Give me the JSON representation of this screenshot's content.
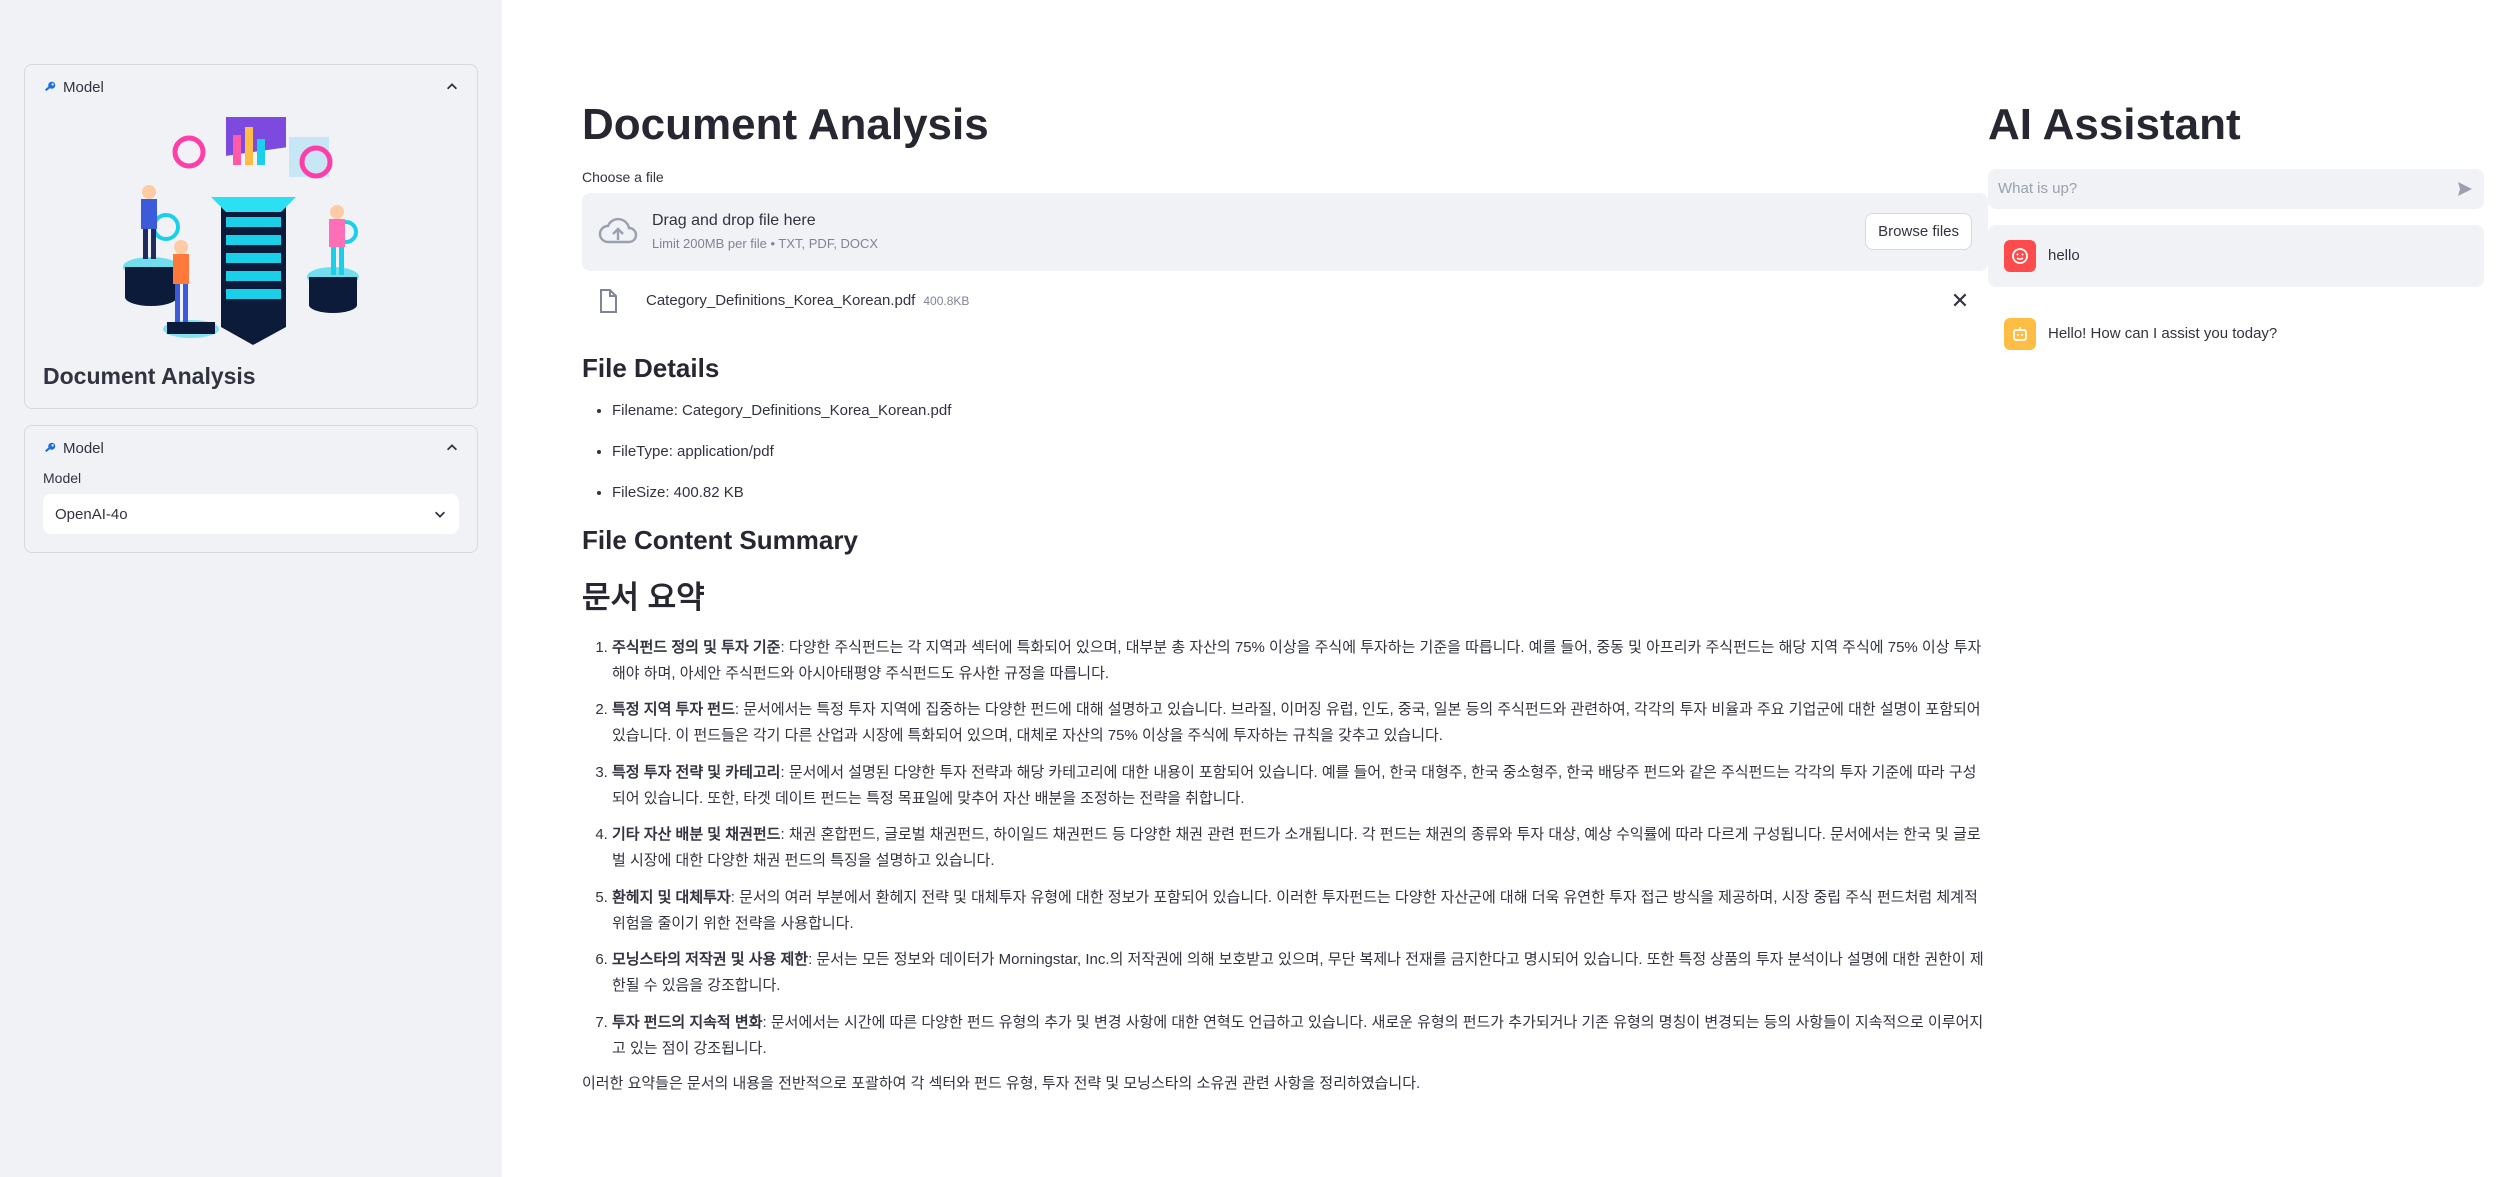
{
  "sidebar": {
    "illustration_expander": {
      "label": "Model",
      "title": "Document Analysis"
    },
    "model_expander": {
      "label": "Model",
      "field_label": "Model",
      "selected_value": "OpenAI-4o"
    }
  },
  "main": {
    "title": "Document Analysis",
    "uploader": {
      "label": "Choose a file",
      "drop_text": "Drag and drop file here",
      "limit_text": "Limit 200MB per file • TXT, PDF, DOCX",
      "browse_label": "Browse files",
      "file_name": "Category_Definitions_Korea_Korean.pdf",
      "file_size": "400.8KB"
    },
    "file_details": {
      "heading": "File Details",
      "items": [
        "Filename: Category_Definitions_Korea_Korean.pdf",
        "FileType: application/pdf",
        "FileSize: 400.82 KB"
      ]
    },
    "summary": {
      "heading": "File Content Summary",
      "subheading": "문서 요약",
      "items": [
        {
          "bold": "주식펀드 정의 및 투자 기준",
          "text": ": 다양한 주식펀드는 각 지역과 섹터에 특화되어 있으며, 대부분 총 자산의 75% 이상을 주식에 투자하는 기준을 따릅니다. 예를 들어, 중동 및 아프리카 주식펀드는 해당 지역 주식에 75% 이상 투자해야 하며, 아세안 주식펀드와 아시아태평양 주식펀드도 유사한 규정을 따릅니다."
        },
        {
          "bold": "특정 지역 투자 펀드",
          "text": ": 문서에서는 특정 투자 지역에 집중하는 다양한 펀드에 대해 설명하고 있습니다. 브라질, 이머징 유럽, 인도, 중국, 일본 등의 주식펀드와 관련하여, 각각의 투자 비율과 주요 기업군에 대한 설명이 포함되어 있습니다. 이 펀드들은 각기 다른 산업과 시장에 특화되어 있으며, 대체로 자산의 75% 이상을 주식에 투자하는 규칙을 갖추고 있습니다."
        },
        {
          "bold": "특정 투자 전략 및 카테고리",
          "text": ": 문서에서 설명된 다양한 투자 전략과 해당 카테고리에 대한 내용이 포함되어 있습니다. 예를 들어, 한국 대형주, 한국 중소형주, 한국 배당주 펀드와 같은 주식펀드는 각각의 투자 기준에 따라 구성되어 있습니다. 또한, 타겟 데이트 펀드는 특정 목표일에 맞추어 자산 배분을 조정하는 전략을 취합니다."
        },
        {
          "bold": "기타 자산 배분 및 채권펀드",
          "text": ": 채권 혼합펀드, 글로벌 채권펀드, 하이일드 채권펀드 등 다양한 채권 관련 펀드가 소개됩니다. 각 펀드는 채권의 종류와 투자 대상, 예상 수익률에 따라 다르게 구성됩니다. 문서에서는 한국 및 글로벌 시장에 대한 다양한 채권 펀드의 특징을 설명하고 있습니다."
        },
        {
          "bold": "환헤지 및 대체투자",
          "text": ": 문서의 여러 부분에서 환헤지 전략 및 대체투자 유형에 대한 정보가 포함되어 있습니다. 이러한 투자펀드는 다양한 자산군에 대해 더욱 유연한 투자 접근 방식을 제공하며, 시장 중립 주식 펀드처럼 체계적 위험을 줄이기 위한 전략을 사용합니다."
        },
        {
          "bold": "모닝스타의 저작권 및 사용 제한",
          "text": ": 문서는 모든 정보와 데이터가 Morningstar, Inc.의 저작권에 의해 보호받고 있으며, 무단 복제나 전재를 금지한다고 명시되어 있습니다. 또한 특정 상품의 투자 분석이나 설명에 대한 권한이 제한될 수 있음을 강조합니다."
        },
        {
          "bold": "투자 펀드의 지속적 변화",
          "text": ": 문서에서는 시간에 따른 다양한 펀드 유형의 추가 및 변경 사항에 대한 연혁도 언급하고 있습니다. 새로운 유형의 펀드가 추가되거나 기존 유형의 명칭이 변경되는 등의 사항들이 지속적으로 이루어지고 있는 점이 강조됩니다."
        }
      ],
      "closing": "이러한 요약들은 문서의 내용을 전반적으로 포괄하여 각 섹터와 펀드 유형, 투자 전략 및 모닝스타의 소유권 관련 사항을 정리하였습니다."
    }
  },
  "assistant": {
    "title": "AI Assistant",
    "input_placeholder": "What is up?",
    "messages": [
      {
        "role": "user",
        "text": "hello"
      },
      {
        "role": "assistant",
        "text": "Hello! How can I assist you today?"
      }
    ]
  },
  "colors": {
    "sidebar_bg": "#f0f2f6",
    "user_avatar": "#ff4b4b",
    "bot_avatar": "#ffbd45",
    "text": "#31333f"
  }
}
